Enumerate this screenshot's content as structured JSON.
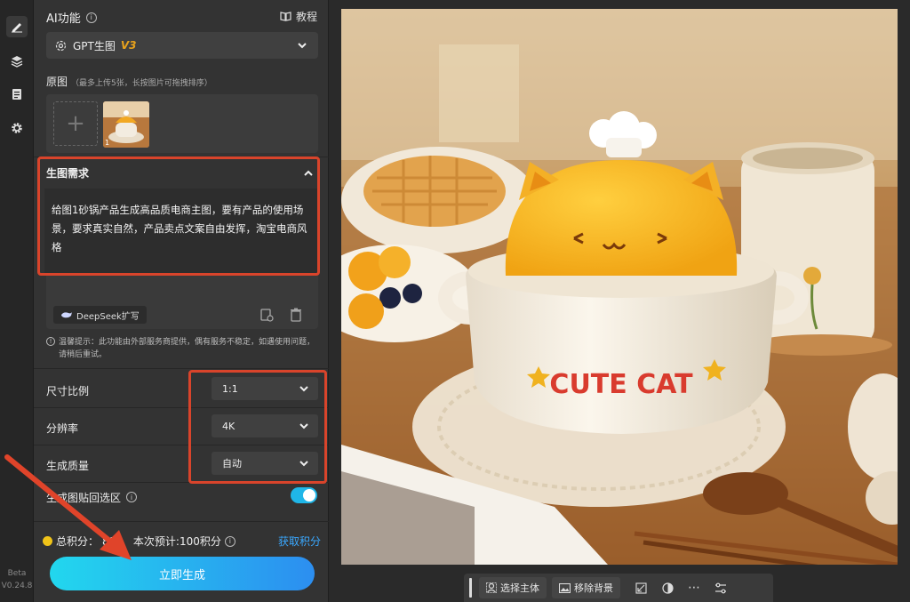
{
  "rail": {
    "icons": [
      "edit-icon",
      "layers-icon",
      "document-icon",
      "settings-icon"
    ],
    "version_label": "Beta",
    "version": "V0.24.8"
  },
  "panel": {
    "title": "AI功能",
    "title_info": "i",
    "tutorial": "教程",
    "model": {
      "name": "GPT生图",
      "version": "V3"
    },
    "source": {
      "label": "原图",
      "hint": "（最多上传5张，长按图片可拖拽排序）",
      "add_glyph": "+",
      "thumb_index": "1"
    },
    "requirement": {
      "label": "生图需求",
      "text": "给图1砂锅产品生成高品质电商主图，要有产品的使用场景，要求真实自然，产品卖点文案自由发挥，淘宝电商风格",
      "deepseek_button": "DeepSeek扩写"
    },
    "notice": "温馨提示：此功能由外部服务商提供，偶有服务不稳定，如遇使用问题，请稍后重试。",
    "settings": [
      {
        "label": "尺寸比例",
        "value": "1:1"
      },
      {
        "label": "分辨率",
        "value": "4K"
      },
      {
        "label": "生成质量",
        "value": "自动"
      }
    ],
    "paste_back": {
      "label": "生成图贴回选区",
      "enabled": true
    },
    "points": {
      "total_label": "总积分：",
      "total_value": "889",
      "estimate": "本次预计:100积分",
      "get_points": "获取积分"
    },
    "generate_button": "立即生成"
  },
  "canvas": {
    "product_text": "CUTE CAT",
    "toolbar": {
      "select_subject": "选择主体",
      "remove_background": "移除背景",
      "more": "⋯"
    }
  },
  "colors": {
    "accent": "#1fb6e8",
    "annotation_red": "#d9442b",
    "v3_gold": "#e8a21c",
    "link_blue": "#3aa8ff"
  }
}
